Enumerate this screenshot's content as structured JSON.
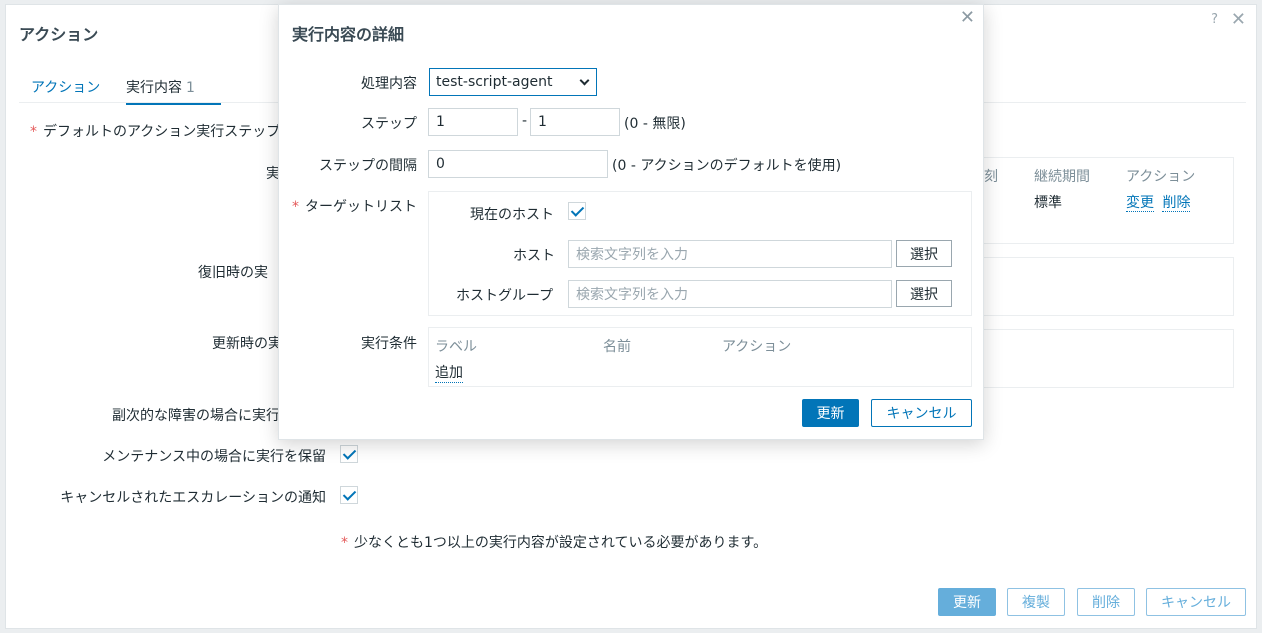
{
  "background": {
    "title": "アクション",
    "help_glyph": "?",
    "close_glyph": "✕",
    "tabs": [
      {
        "label": "アクション"
      },
      {
        "label": "実行内容",
        "count": "1"
      }
    ],
    "required_note": "デフォルトのアクション実行ステップ",
    "labels": {
      "operations": "実",
      "recovery": "復旧時の実",
      "update": "更新時の実",
      "secondary": "副次的な障害の場合に実行",
      "maintenance": "メンテナンス中の場合に実行を保留",
      "cancelled": "キャンセルされたエスカレーションの通知"
    },
    "operations_table": {
      "col_partial": "刻",
      "col_duration": "継続期間",
      "col_action": "アクション",
      "duration_value": "標準",
      "edit_link": "変更",
      "delete_link": "削除"
    },
    "footnote": "少なくとも1つ以上の実行内容が設定されている必要があります。",
    "buttons": {
      "update": "更新",
      "clone": "複製",
      "delete": "削除",
      "cancel": "キャンセル"
    }
  },
  "modal": {
    "title": "実行内容の詳細",
    "close_glyph": "✕",
    "operation_label": "処理内容",
    "operation_value": "test-script-agent",
    "steps_label": "ステップ",
    "step_from": "1",
    "step_sep": "-",
    "step_to": "1",
    "steps_hint": "(0 - 無限)",
    "interval_label": "ステップの間隔",
    "interval_value": "0",
    "interval_hint": "(0 - アクションのデフォルトを使用)",
    "target_label": "ターゲットリスト",
    "current_host_label": "現在のホスト",
    "host_label": "ホスト",
    "host_placeholder": "検索文字列を入力",
    "hostgroup_label": "ホストグループ",
    "hostgroup_placeholder": "検索文字列を入力",
    "select_label": "選択",
    "conditions_label": "実行条件",
    "cond_cols": {
      "label": "ラベル",
      "name": "名前",
      "action": "アクション"
    },
    "add_link": "追加",
    "update_button": "更新",
    "cancel_button": "キャンセル"
  }
}
